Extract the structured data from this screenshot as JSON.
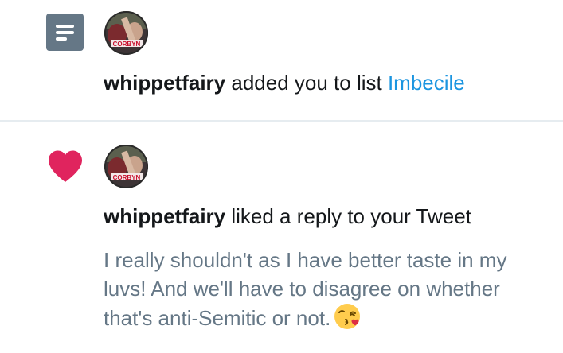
{
  "notifications": [
    {
      "type": "list",
      "icon": "list-icon",
      "avatar": {
        "icon": "user-avatar-icon",
        "overlay_text": "CORBYN"
      },
      "user": "whippetfairy",
      "action_text": " added you to list ",
      "list_name": "Imbecile"
    },
    {
      "type": "like",
      "icon": "heart-icon",
      "avatar": {
        "icon": "user-avatar-icon",
        "overlay_text": "CORBYN"
      },
      "user": "whippetfairy",
      "action_text": " liked a reply to your Tweet",
      "tweet_text": "I really shouldn't as I have better taste in my luvs! And we'll have to disagree on whether that's anti-Semitic or not.",
      "emoji": "face-blowing-a-kiss-emoji"
    }
  ],
  "colors": {
    "heart": "#e0245e",
    "list_icon_bg": "#657786",
    "link": "#1b95e0",
    "text_primary": "#14171a",
    "text_secondary": "#657786",
    "divider": "#e6ecf0"
  }
}
